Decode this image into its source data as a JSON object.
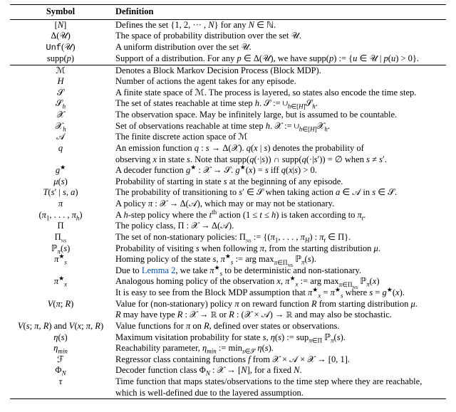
{
  "headers": {
    "symbol": "Symbol",
    "definition": "Definition"
  },
  "groups": [
    {
      "rows": [
        {
          "sym": "[<i>N</i>]",
          "def": "Defines the set {1, 2, ··· , <i>N</i>} for any <i>N</i> ∈ ℕ."
        },
        {
          "sym": "Δ(𝒰)",
          "def": "The space of probability distribution over the set 𝒰."
        },
        {
          "sym": "<span class=\"tt\">Unf</span>(𝒰)",
          "def": "A uniform distribution over the set 𝒰."
        },
        {
          "sym": "supp(<i>p</i>)",
          "def": "Support of a distribution. For any <i>p</i> ∈ Δ(𝒰), we have supp(<i>p</i>) := {<i>u</i> ∈ 𝒰 | <i>p</i>(<i>u</i>) &gt; 0}."
        }
      ]
    },
    {
      "rows": [
        {
          "sym": "ℳ",
          "def": "Denotes a Block Markov Decision Process (Block MDP)."
        },
        {
          "sym": "<i>H</i>",
          "def": "Number of actions the agent takes for any episode."
        },
        {
          "sym": "𝒮",
          "def": "A finite state space of ℳ. The process is layered, so states also encode the time step."
        },
        {
          "sym": "𝒮<sub><i>h</i></sub>",
          "def": "The set of states reachable at time step <i>h</i>. 𝒮 := ∪<sub><i>h</i>∈[<i>H</i>]</sub>𝒮<sub><i>h</i></sub>."
        },
        {
          "sym": "𝒳",
          "def": "The observation space. May be infinitely large, but is assumed to be countable."
        },
        {
          "sym": "𝒳<sub><i>h</i></sub>",
          "def": "Set of observations reachable at time step <i>h</i>. 𝒳 := ∪<sub><i>h</i>∈[<i>H</i>]</sub>𝒳<sub><i>h</i></sub>."
        },
        {
          "sym": "𝒜",
          "def": "The finite discrete action space of ℳ"
        },
        {
          "sym": "<i>q</i>",
          "def": "An emission function <i>q</i> : <i>s</i> → Δ(𝒳). <i>q</i>(<i>x</i> | <i>s</i>) denotes the probability of"
        },
        {
          "sym": "",
          "def": "observing <i>x</i> in state <i>s</i>. Note that supp(<i>q</i>(·|<i>s</i>)) ∩ supp(<i>q</i>(·|<i>s</i>′)) = ∅ when <i>s</i> ≠ <i>s</i>′."
        },
        {
          "sym": "<i>g</i><sup>★</sup>",
          "def": "A decoder function <i>g</i><sup>★</sup> : 𝒳 → 𝒮. <i>g</i><sup>★</sup>(<i>x</i>) = <i>s</i> iff <i>q</i>(<i>x</i>|<i>s</i>) &gt; 0."
        },
        {
          "sym": "<i>μ</i>(<i>s</i>)",
          "def": "Probability of starting in state <i>s</i> at the beginning of any episode."
        },
        {
          "sym": "<i>T</i>(<i>s</i>′ | <i>s</i>, <i>a</i>)",
          "def": "The probability of transitioning to <i>s</i>′ ∈ 𝒮 when taking action <i>a</i> ∈ 𝒜 in <i>s</i> ∈ 𝒮."
        },
        {
          "sym": "<i>π</i>",
          "def": "A policy <i>π</i> : 𝒳 → Δ(𝒜), which may or may not be stationary."
        },
        {
          "sym": "(<i>π</i><sub>1</sub>, . . . , <i>π</i><sub><i>h</i></sub>)",
          "def": "A <i>h</i>-step policy where the <i>t</i><sup>th</sup> action (1 ≤ <i>t</i> ≤ <i>h</i>) is taken according to <i>π</i><sub><i>t</i></sub>."
        },
        {
          "sym": "Π",
          "def": "The policy class, Π : 𝒳 → Δ(𝒜)."
        },
        {
          "sym": "Π<sub><span class=\"sc\">ns</span></sub>",
          "def": "The set of non-stationary policies: Π<sub><span class=\"sc\">ns</span></sub> := {(<i>π</i><sub>1</sub>, . . . , <i>π</i><sub><i>H</i></sub>) : <i>π</i><sub><i>t</i></sub> ∈ Π}."
        },
        {
          "sym": "ℙ<sub><i>π</i></sub>(<i>s</i>)",
          "def": "Probability of visiting <i>s</i> when following <i>π</i>, from the starting distribution <i>μ</i>."
        },
        {
          "sym": "<i>π</i><sup>★</sup><sub><i>s</i></sub>",
          "def": "Homing policy of the state <i>s</i>, <i>π</i><sup>★</sup><sub><i>s</i></sub> := arg max<sub><i>π</i>∈Π<sub><span class=\"sc\">ns</span></sub></sub> ℙ<sub><i>π</i></sub>(<i>s</i>)."
        },
        {
          "sym": "",
          "def": "Due to <span class=\"link\">Lemma 2</span>, we take <i>π</i><sup>★</sup><sub><i>s</i></sub> to be deterministic and non-stationary."
        },
        {
          "sym": "<i>π</i><sup>★</sup><sub><i>x</i></sub>",
          "def": "Analogous homing policy of the observation <i>x</i>, <i>π</i><sup>★</sup><sub><i>x</i></sub> := arg max<sub><i>π</i>∈Π<sub><span class=\"sc\">ns</span></sub></sub> ℙ<sub><i>π</i></sub>(<i>x</i>)"
        },
        {
          "sym": "",
          "def": "It is easy to see from the Block MDP assumption that <i>π</i><sup>★</sup><sub><i>x</i></sub> = <i>π</i><sup>★</sup><sub><i>s</i></sub> where <i>s</i> = <i>g</i><sup>★</sup>(<i>x</i>)."
        },
        {
          "sym": "<i>V</i>(<i>π</i>; <i>R</i>)",
          "def": "Value for (non-stationary) policy <i>π</i> on reward function <i>R</i> from starting distribution <i>μ</i>."
        },
        {
          "sym": "",
          "def": "<i>R</i> may have type <i>R</i> : 𝒳 → ℝ or <i>R</i> : (𝒳 × 𝒜) → ℝ and may also be stochastic."
        },
        {
          "sym": "<i>V</i>(<i>s</i>; <i>π</i>, <i>R</i>) and <i>V</i>(<i>x</i>; <i>π</i>, <i>R</i>)",
          "def": "Value functions for <i>π</i> on <i>R</i>, defined over states or observations."
        },
        {
          "sym": "<i>η</i>(<i>s</i>)",
          "def": "Maximum visitation probability for state <i>s</i>, <i>η</i>(<i>s</i>) := sup<sub><i>π</i>∈Π</sub> ℙ<sub><i>π</i></sub>(<i>s</i>)."
        },
        {
          "sym": "<i>η</i><sub><i>min</i></sub>",
          "def": "Reachability parameter, <i>η</i><sub><i>min</i></sub> := min<sub><i>s</i>∈𝒮</sub> <i>η</i>(<i>s</i>)."
        },
        {
          "sym": "ℱ",
          "def": "Regressor class containing functions <i>f</i> from 𝒳 × 𝒜 × 𝒳 → [0, 1]."
        },
        {
          "sym": "Φ<sub><i>N</i></sub>",
          "def": "Decoder function class Φ<sub><i>N</i></sub> : 𝒳 → [<i>N</i>], for a fixed <i>N</i>."
        },
        {
          "sym": "<i>τ</i>",
          "def": "Time function that maps states/observations to the time step where they are reachable,"
        },
        {
          "sym": "",
          "def": "which is well-defined due to the layered assumption."
        }
      ]
    }
  ]
}
